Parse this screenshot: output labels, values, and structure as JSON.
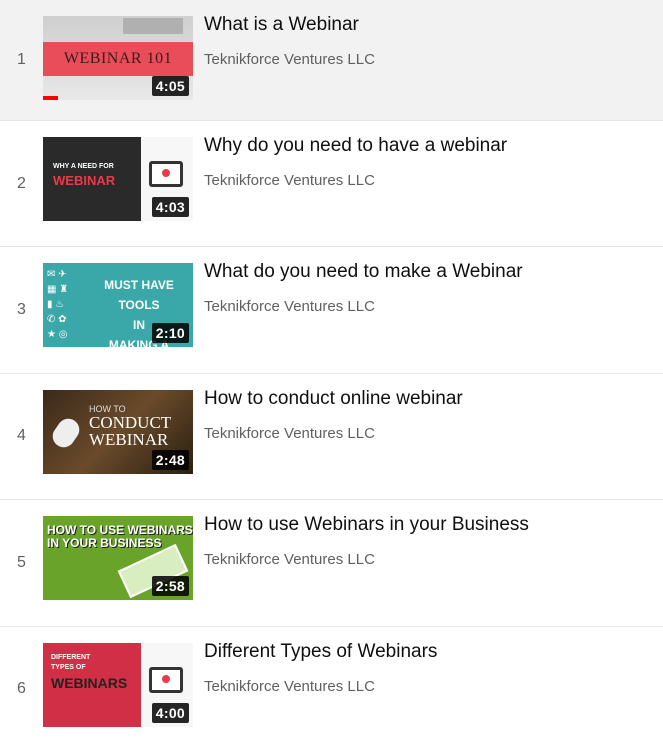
{
  "playlist": {
    "items": [
      {
        "index": "1",
        "title": "What is a Webinar",
        "channel": "Teknikforce Ventures LLC",
        "duration": "4:05",
        "thumb_text": "WEBINAR 101",
        "watched_progress": 0.1
      },
      {
        "index": "2",
        "title": "Why do you need to have a webinar",
        "channel": "Teknikforce Ventures LLC",
        "duration": "4:03",
        "thumb_small": "WHY A NEED FOR",
        "thumb_big": "WEBINAR"
      },
      {
        "index": "3",
        "title": "What do you need to make a Webinar",
        "channel": "Teknikforce Ventures LLC",
        "duration": "2:10",
        "thumb_text_1": "MUST HAVE TOOLS",
        "thumb_text_2": "IN",
        "thumb_text_3": "MAKING A WEBINAR"
      },
      {
        "index": "4",
        "title": "How to conduct online webinar",
        "channel": "Teknikforce Ventures LLC",
        "duration": "2:48",
        "thumb_small": "HOW TO",
        "thumb_big_1": "CONDUCT",
        "thumb_big_2": "WEBINAR"
      },
      {
        "index": "5",
        "title": "How to use Webinars in your Business",
        "channel": "Teknikforce Ventures LLC",
        "duration": "2:58",
        "thumb_text_1": "HOW TO USE WEBINARS",
        "thumb_text_2": "IN YOUR BUSINESS"
      },
      {
        "index": "6",
        "title": "Different Types of Webinars",
        "channel": "Teknikforce Ventures LLC",
        "duration": "4:00",
        "thumb_small_1": "DIFFERENT",
        "thumb_small_2": "TYPES OF",
        "thumb_big": "WEBINARS"
      }
    ]
  }
}
